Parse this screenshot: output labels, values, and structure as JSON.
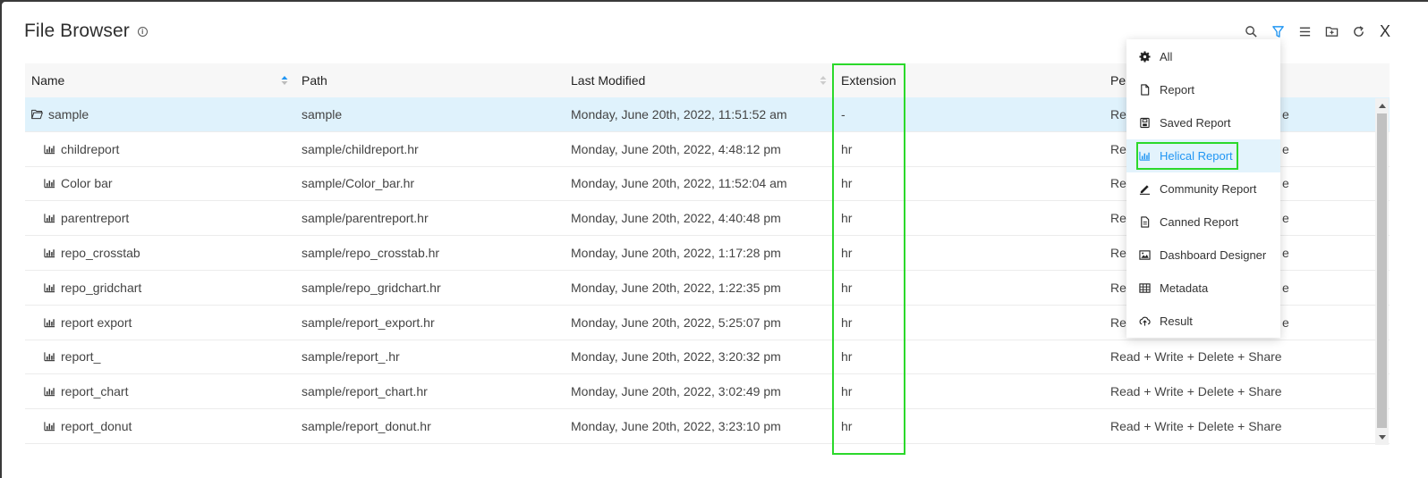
{
  "header": {
    "title": "File Browser",
    "info_glyph": "i"
  },
  "toolbar": {
    "icons": [
      "search-icon",
      "filter-icon",
      "list-icon",
      "new-folder-icon",
      "refresh-icon",
      "close-icon"
    ],
    "close_label": "X"
  },
  "columns": {
    "name": "Name",
    "path": "Path",
    "modified": "Last Modified",
    "extension": "Extension",
    "permissions": "Pe"
  },
  "rows": [
    {
      "name": "sample",
      "path": "sample",
      "modified": "Monday, June 20th, 2022, 11:51:52 am",
      "extension": "-",
      "permissions": "Re",
      "tail": "e",
      "type": "folder"
    },
    {
      "name": "childreport",
      "path": "sample/childreport.hr",
      "modified": "Monday, June 20th, 2022, 4:48:12 pm",
      "extension": "hr",
      "permissions": "Re",
      "tail": "e",
      "type": "report"
    },
    {
      "name": "Color bar",
      "path": "sample/Color_bar.hr",
      "modified": "Monday, June 20th, 2022, 11:52:04 am",
      "extension": "hr",
      "permissions": "Re",
      "tail": "e",
      "type": "report"
    },
    {
      "name": "parentreport",
      "path": "sample/parentreport.hr",
      "modified": "Monday, June 20th, 2022, 4:40:48 pm",
      "extension": "hr",
      "permissions": "Re",
      "tail": "e",
      "type": "report"
    },
    {
      "name": "repo_crosstab",
      "path": "sample/repo_crosstab.hr",
      "modified": "Monday, June 20th, 2022, 1:17:28 pm",
      "extension": "hr",
      "permissions": "Re",
      "tail": "e",
      "type": "report"
    },
    {
      "name": "repo_gridchart",
      "path": "sample/repo_gridchart.hr",
      "modified": "Monday, June 20th, 2022, 1:22:35 pm",
      "extension": "hr",
      "permissions": "Re",
      "tail": "e",
      "type": "report"
    },
    {
      "name": "report export",
      "path": "sample/report_export.hr",
      "modified": "Monday, June 20th, 2022, 5:25:07 pm",
      "extension": "hr",
      "permissions": "Re",
      "tail": "e",
      "type": "report"
    },
    {
      "name": "report_",
      "path": "sample/report_.hr",
      "modified": "Monday, June 20th, 2022, 3:20:32 pm",
      "extension": "hr",
      "permissions": "Read + Write + Delete + Share",
      "tail": "",
      "type": "report"
    },
    {
      "name": "report_chart",
      "path": "sample/report_chart.hr",
      "modified": "Monday, June 20th, 2022, 3:02:49 pm",
      "extension": "hr",
      "permissions": "Read + Write + Delete + Share",
      "tail": "",
      "type": "report"
    },
    {
      "name": "report_donut",
      "path": "sample/report_donut.hr",
      "modified": "Monday, June 20th, 2022, 3:23:10 pm",
      "extension": "hr",
      "permissions": "Read + Write + Delete + Share",
      "tail": "",
      "type": "report"
    }
  ],
  "filter_menu": {
    "items": [
      {
        "label": "All",
        "icon": "gear-icon"
      },
      {
        "label": "Report",
        "icon": "file-icon"
      },
      {
        "label": "Saved Report",
        "icon": "saved-file-icon"
      },
      {
        "label": "Helical Report",
        "icon": "bar-chart-icon",
        "active": true
      },
      {
        "label": "Community Report",
        "icon": "pencil-icon"
      },
      {
        "label": "Canned Report",
        "icon": "document-icon"
      },
      {
        "label": "Dashboard Designer",
        "icon": "image-icon"
      },
      {
        "label": "Metadata",
        "icon": "table-icon"
      },
      {
        "label": "Result",
        "icon": "cloud-upload-icon"
      }
    ]
  },
  "colors": {
    "accent": "#2196f3",
    "selected_row": "#dff2fc",
    "highlight_box": "#2bd92b"
  }
}
